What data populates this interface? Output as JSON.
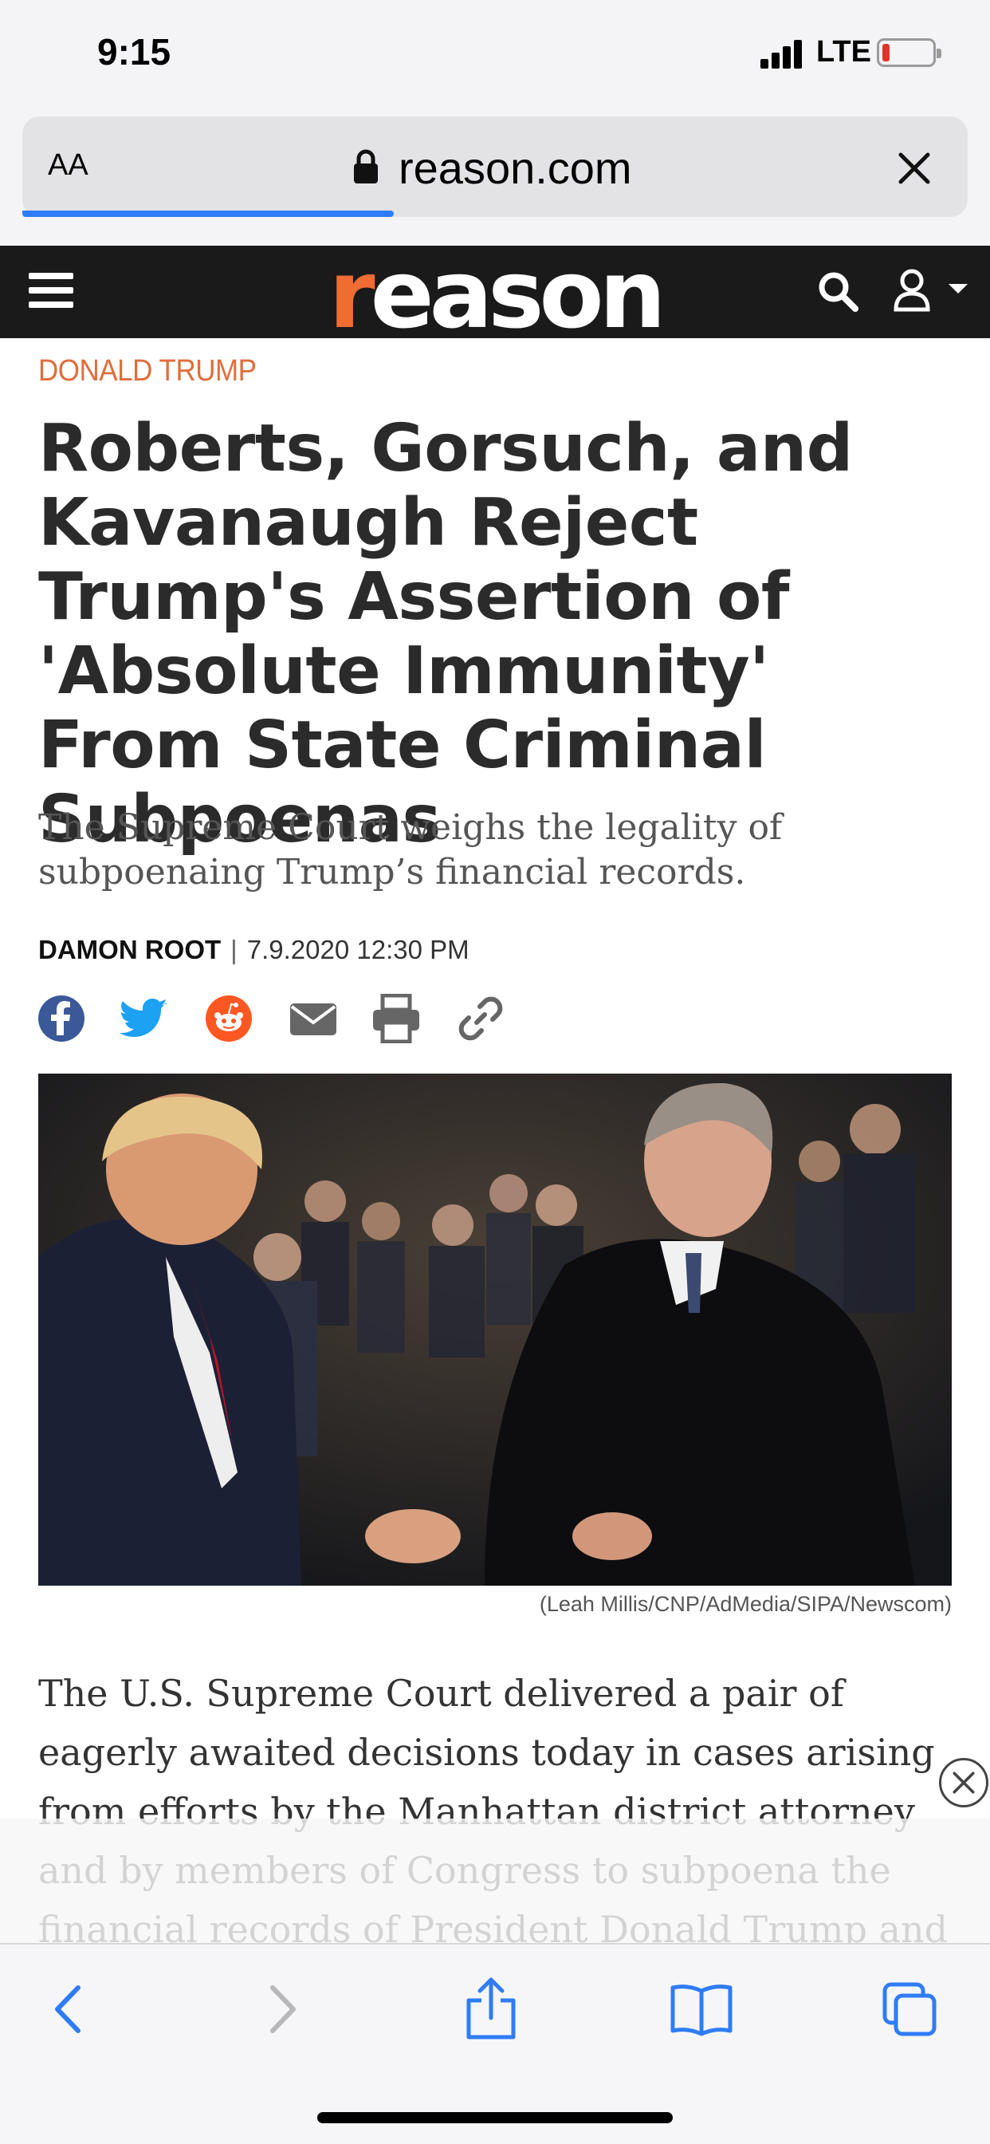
{
  "status_bar": {
    "time": "9:15",
    "network": "LTE",
    "battery_color": "#e0352b"
  },
  "address_bar": {
    "reader_button": "AA",
    "url": "reason.com",
    "accent": "#2f7cf6"
  },
  "site_header": {
    "logo": "reason",
    "logo_first_letter": "r",
    "logo_rest": "eason",
    "accent": "#ef6c32",
    "icons": [
      "hamburger-menu-icon",
      "search-icon",
      "user-icon",
      "caret-down-icon"
    ]
  },
  "article": {
    "section": "DONALD TRUMP",
    "headline": "Roberts, Gorsuch, and Kavanaugh Reject Trump's Assertion of 'Absolute Immunity' From State Criminal Subpoenas",
    "dek": "The Supreme Court weighs the legality of subpoenaing Trump’s financial records.",
    "author": "DAMON ROOT",
    "separator": "|",
    "date": "7.9.2020 12:30 PM",
    "share_icons": [
      "facebook-icon",
      "twitter-icon",
      "reddit-icon",
      "email-icon",
      "print-icon",
      "link-icon"
    ],
    "photo_credit": "(Leah Millis/CNP/AdMedia/SIPA/Newscom)",
    "body": "The U.S. Supreme Court delivered a pair of eagerly awaited decisions today in cases arising from efforts by the Manhattan district attorney and by members of Congress to subpoena the financial records of President Donald Trump and several of his business"
  },
  "toolbar": {
    "icons": [
      "back-icon",
      "forward-icon",
      "share-icon",
      "bookmarks-icon",
      "tabs-icon"
    ]
  }
}
